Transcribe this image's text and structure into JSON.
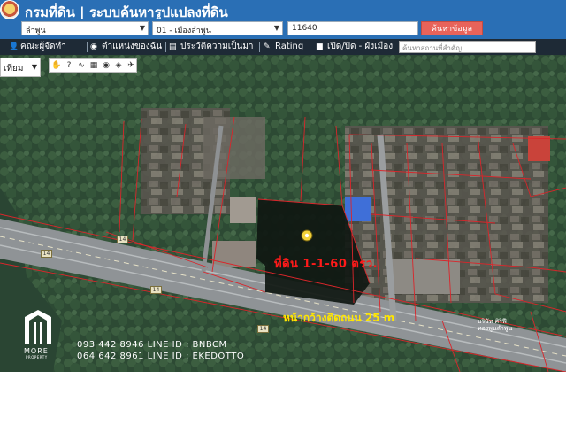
{
  "header": {
    "title": "กรมที่ดิน | ระบบค้นหารูปแปลงที่ดิน"
  },
  "search": {
    "province": "ลำพูน",
    "district": "01 - เมืองลำพูน",
    "parcel_no": "11640",
    "button_label": "ค้นหาข้อมูล"
  },
  "toolbar": {
    "items": [
      {
        "label": "คณะผู้จัดทำ",
        "icon": "person-icon"
      },
      {
        "label": "ตำแหน่งของฉัน",
        "icon": "location-icon"
      },
      {
        "label": "ประวัติความเป็นมา",
        "icon": "document-icon"
      },
      {
        "label": "Rating",
        "icon": "rating-icon"
      },
      {
        "label": "เปิด/ปิด - ผังเมือง",
        "icon": "checkbox-icon"
      }
    ],
    "place_placeholder": "ค้นหาสถานที่สำคัญ"
  },
  "map": {
    "layer_selected": "เทียม",
    "road_label": "14",
    "land_label": "ที่ดิน   1-1-60  ตรว.",
    "frontage_label": "หน้ากว้างติดถนน   25  m",
    "poi_label_line1": "บริษัท ศิริฟี",
    "poi_label_line2": "ทองพูนลำพูน",
    "colors": {
      "parcel_line": "#d9262b",
      "highlight": "#111a12",
      "marker": "#f2d23a"
    }
  },
  "overlay": {
    "contact_line1": "093 442 8946 LINE ID : BNBCM",
    "contact_line2": "064 642 8961 LINE ID : EKEDOTTO",
    "brand_name": "MORE",
    "brand_sub": "PROPERTY"
  }
}
